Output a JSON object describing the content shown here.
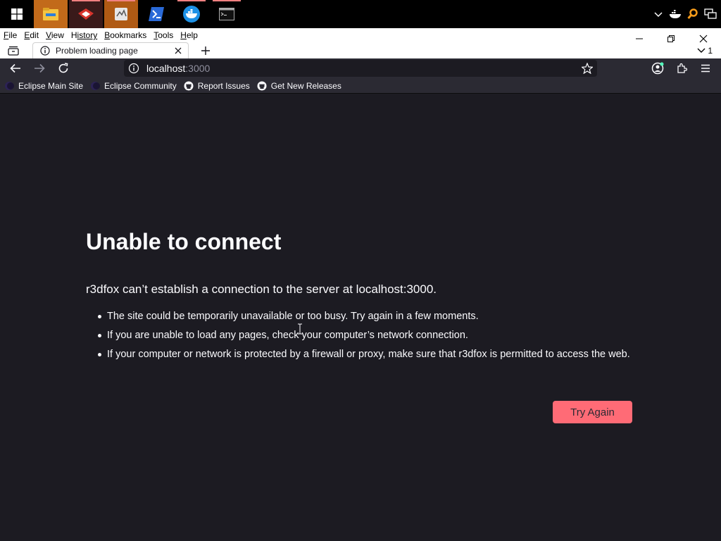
{
  "taskbar": {
    "apps": [
      {
        "name": "file-explorer-icon",
        "active": true
      },
      {
        "name": "app-red-icon",
        "active": false,
        "running": true
      },
      {
        "name": "app-notepad-icon",
        "active": true,
        "running": true
      },
      {
        "name": "powershell-icon",
        "active": false
      },
      {
        "name": "docker-icon",
        "active": false,
        "running": true
      },
      {
        "name": "terminal-icon",
        "active": false,
        "running": true
      }
    ]
  },
  "menubar": {
    "items": [
      {
        "key": "F",
        "rest": "ile"
      },
      {
        "key": "E",
        "rest": "dit"
      },
      {
        "key": "V",
        "rest": "iew"
      },
      {
        "key": "H",
        "rest": "istory",
        "full": "History"
      },
      {
        "key": "B",
        "rest": "ookmarks"
      },
      {
        "key": "T",
        "rest": "ools"
      },
      {
        "key": "H",
        "rest": "elp"
      }
    ]
  },
  "tab": {
    "title": "Problem loading page",
    "list_count": "1"
  },
  "navbar": {
    "url_host": "localhost",
    "url_port": ":3000"
  },
  "bookmarks": [
    {
      "label": "Eclipse Main Site",
      "icon": "eclipse-icon"
    },
    {
      "label": "Eclipse Community",
      "icon": "eclipse-icon"
    },
    {
      "label": "Report Issues",
      "icon": "github-icon"
    },
    {
      "label": "Get New Releases",
      "icon": "github-icon"
    }
  ],
  "error": {
    "title": "Unable to connect",
    "short_desc": "r3dfox can’t establish a connection to the server at localhost:3000.",
    "items": [
      "The site could be temporarily unavailable or too busy. Try again in a few moments.",
      "If you are unable to load any pages, check your computer’s network connection.",
      "If your computer or network is protected by a firewall or proxy, make sure that r3dfox is permitted to access the web."
    ],
    "button_label": "Try Again"
  },
  "colors": {
    "page_bg": "#1c1b22",
    "toolbar_bg": "#2b2a33",
    "button_bg": "#ff6b76"
  }
}
